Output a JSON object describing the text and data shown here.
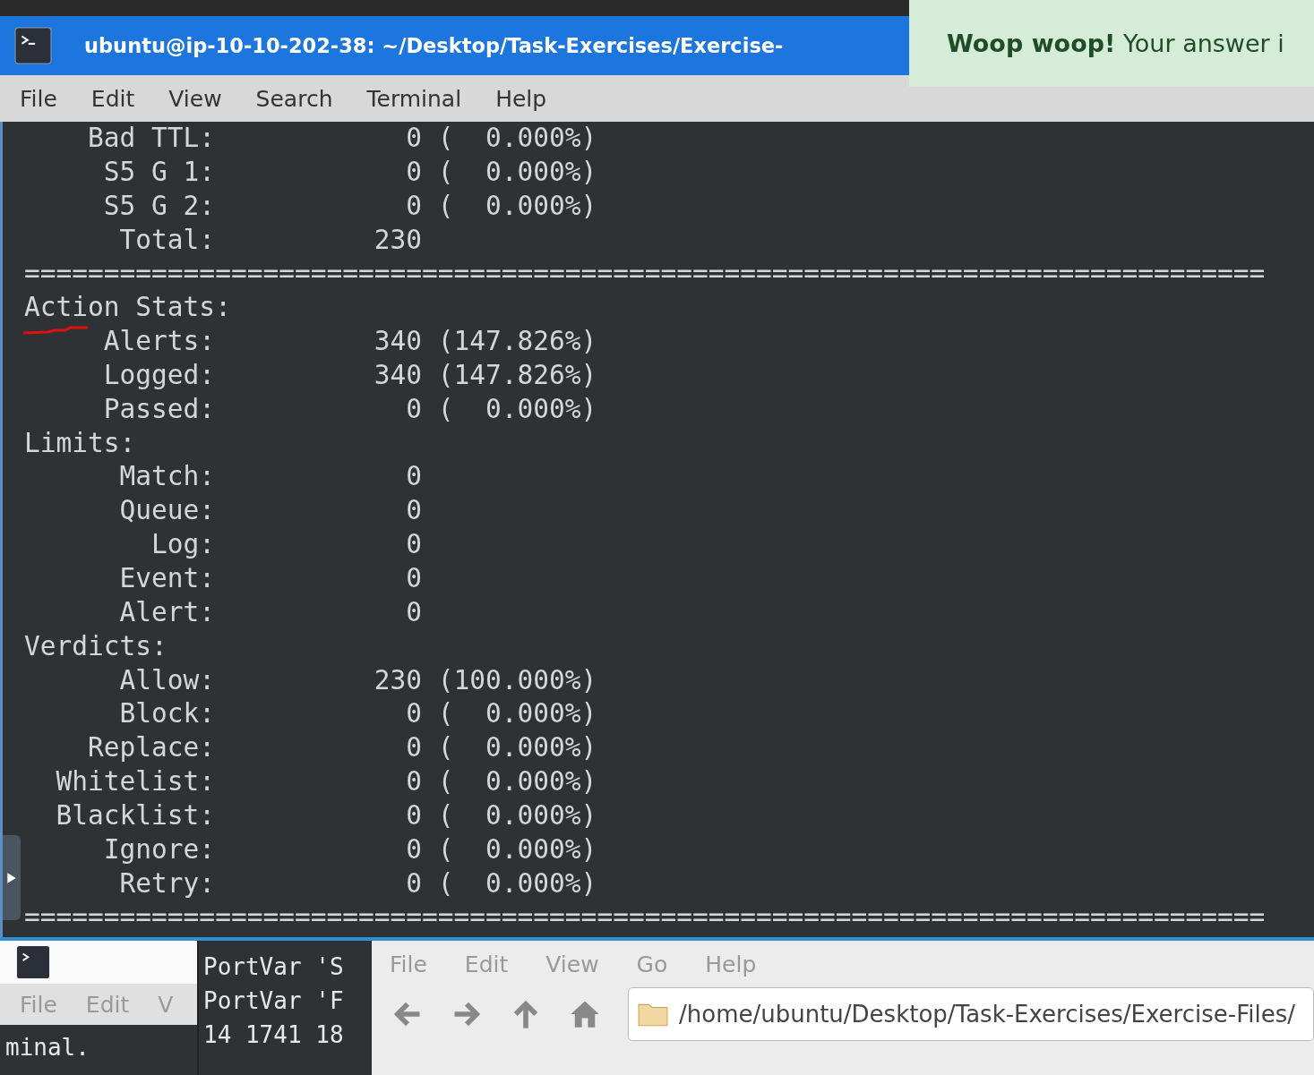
{
  "notification": {
    "text": "**Woop woop!** Your answer i"
  },
  "window": {
    "title": "ubuntu@ip-10-10-202-38: ~/Desktop/Task-Exercises/Exercise-"
  },
  "menu": [
    "File",
    "Edit",
    "View",
    "Search",
    "Terminal",
    "Help"
  ],
  "terminal": {
    "lines": [
      "    Bad TTL:            0 (  0.000%)",
      "     S5 G 1:            0 (  0.000%)",
      "     S5 G 2:            0 (  0.000%)",
      "      Total:          230",
      "==============================================================================",
      "Action Stats:",
      "     Alerts:          340 (147.826%)",
      "     Logged:          340 (147.826%)",
      "     Passed:            0 (  0.000%)",
      "Limits:",
      "      Match:            0",
      "      Queue:            0",
      "        Log:            0",
      "      Event:            0",
      "      Alert:            0",
      "Verdicts:",
      "      Allow:          230 (100.000%)",
      "      Block:            0 (  0.000%)",
      "    Replace:            0 (  0.000%)",
      "  Whitelist:            0 (  0.000%)",
      "  Blacklist:            0 (  0.000%)",
      "     Ignore:            0 (  0.000%)",
      "      Retry:            0 (  0.000%)",
      "=============================================================================="
    ]
  },
  "back_terminal": {
    "menu": [
      "File",
      "Edit",
      "V"
    ],
    "lines": [
      "minal."
    ]
  },
  "middle_terminal": {
    "lines": [
      "PortVar 'S",
      "PortVar 'F",
      "14 1741 18"
    ]
  },
  "file_manager": {
    "menu": [
      "File",
      "Edit",
      "View",
      "Go",
      "Help"
    ],
    "path": "/home/ubuntu/Desktop/Task-Exercises/Exercise-Files/"
  }
}
